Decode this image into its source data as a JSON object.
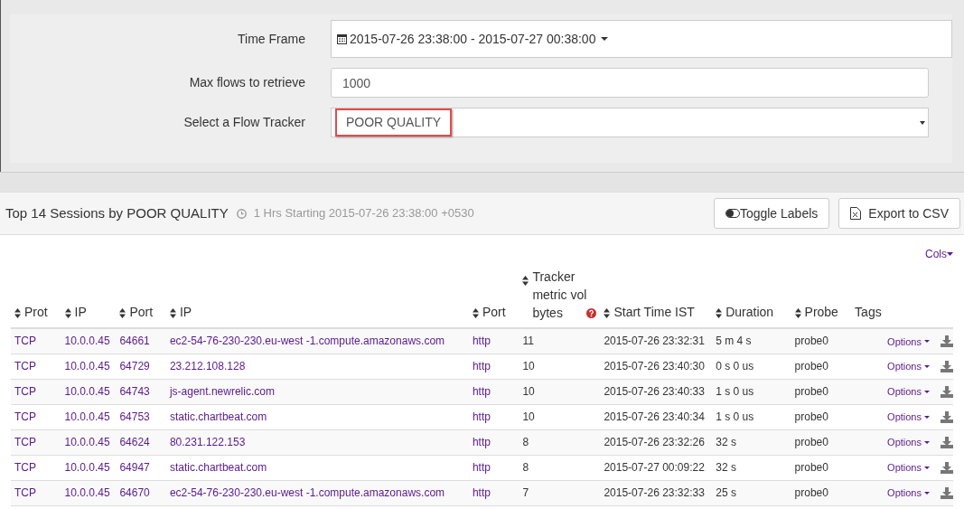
{
  "form": {
    "time_frame": {
      "label": "Time Frame",
      "value": "2015-07-26 23:38:00 - 2015-07-27 00:38:00"
    },
    "max_flows": {
      "label": "Max flows to retrieve",
      "value": "1000"
    },
    "tracker": {
      "label": "Select a Flow Tracker",
      "value": "POOR QUALITY",
      "highlighted": true
    }
  },
  "panel": {
    "title": "Top 14 Sessions by POOR QUALITY",
    "subtitle": "1 Hrs Starting 2015-07-26 23:38:00 +0530",
    "buttons": [
      {
        "kind": "toggle",
        "label": "Toggle Labels"
      },
      {
        "kind": "csv",
        "label": "Export to CSV"
      }
    ],
    "cols_link": "Cols"
  },
  "table": {
    "columns": [
      {
        "label": "Prot",
        "sortable": true,
        "link": true,
        "help": false
      },
      {
        "label": "IP",
        "sortable": true,
        "link": true,
        "help": false
      },
      {
        "label": "Port",
        "sortable": true,
        "link": true,
        "help": false
      },
      {
        "label": "IP",
        "sortable": true,
        "link": true,
        "help": false
      },
      {
        "label": "Port",
        "sortable": true,
        "link": true,
        "help": false
      },
      {
        "label": "Tracker metric vol bytes",
        "sortable": true,
        "link": false,
        "help": true
      },
      {
        "label": "Start Time IST",
        "sortable": true,
        "link": false,
        "help": false
      },
      {
        "label": "Duration",
        "sortable": true,
        "link": false,
        "help": false
      },
      {
        "label": "Probe",
        "sortable": true,
        "link": false,
        "help": false
      },
      {
        "label": "Tags",
        "sortable": false,
        "link": false,
        "help": false
      }
    ],
    "rows": [
      {
        "cells": [
          "TCP",
          "10.0.0.45",
          "64661",
          "ec2-54-76-230-230.eu-west -1.compute.amazonaws.com",
          "http",
          "11",
          "2015-07-26 23:32:31",
          "5 m 4 s",
          "probe0",
          ""
        ],
        "options": "Options"
      },
      {
        "cells": [
          "TCP",
          "10.0.0.45",
          "64729",
          "23.212.108.128",
          "http",
          "10",
          "2015-07-26 23:40:30",
          "0 s 0 us",
          "probe0",
          ""
        ],
        "options": "Options"
      },
      {
        "cells": [
          "TCP",
          "10.0.0.45",
          "64743",
          "js-agent.newrelic.com",
          "http",
          "10",
          "2015-07-26 23:40:33",
          "1 s 0 us",
          "probe0",
          ""
        ],
        "options": "Options"
      },
      {
        "cells": [
          "TCP",
          "10.0.0.45",
          "64753",
          "static.chartbeat.com",
          "http",
          "10",
          "2015-07-26 23:40:34",
          "1 s 0 us",
          "probe0",
          ""
        ],
        "options": "Options"
      },
      {
        "cells": [
          "TCP",
          "10.0.0.45",
          "64624",
          "80.231.122.153",
          "http",
          "8",
          "2015-07-26 23:32:26",
          "32 s",
          "probe0",
          ""
        ],
        "options": "Options"
      },
      {
        "cells": [
          "TCP",
          "10.0.0.45",
          "64947",
          "static.chartbeat.com",
          "http",
          "8",
          "2015-07-27 00:09:22",
          "32 s",
          "probe0",
          ""
        ],
        "options": "Options"
      },
      {
        "cells": [
          "TCP",
          "10.0.0.45",
          "64670",
          "ec2-54-76-230-230.eu-west -1.compute.amazonaws.com",
          "http",
          "7",
          "2015-07-26 23:32:33",
          "25 s",
          "probe0",
          ""
        ],
        "options": "Options"
      }
    ]
  }
}
